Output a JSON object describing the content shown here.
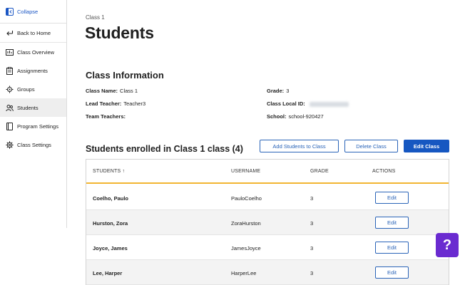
{
  "sidebar": {
    "collapse_label": "Collapse",
    "items": [
      {
        "label": "Back to Home",
        "icon": "arrow-left-icon",
        "active": false
      },
      {
        "label": "Class Overview",
        "icon": "class-overview-icon",
        "active": false
      },
      {
        "label": "Assignments",
        "icon": "clipboard-icon",
        "active": false
      },
      {
        "label": "Groups",
        "icon": "groups-icon",
        "active": false
      },
      {
        "label": "Students",
        "icon": "students-icon",
        "active": true
      },
      {
        "label": "Program Settings",
        "icon": "book-icon",
        "active": false
      },
      {
        "label": "Class Settings",
        "icon": "gear-icon",
        "active": false
      }
    ]
  },
  "header": {
    "breadcrumb": "Class 1",
    "title": "Students"
  },
  "class_info": {
    "title": "Class Information",
    "class_name_label": "Class Name:",
    "class_name": "Class 1",
    "lead_teacher_label": "Lead Teacher:",
    "lead_teacher": "Teacher3",
    "team_teachers_label": "Team Teachers:",
    "grade_label": "Grade:",
    "grade": "3",
    "class_local_id_label": "Class Local ID:",
    "school_label": "School:",
    "school": "school-920427"
  },
  "enrolled": {
    "title": "Students enrolled in Class 1 class (4)",
    "add_button": "Add Students to Class",
    "delete_button": "Delete Class",
    "edit_button": "Edit Class"
  },
  "table": {
    "columns": [
      "STUDENTS ↑",
      "USERNAME",
      "GRADE",
      "ACTIONS"
    ],
    "rows": [
      {
        "name": "Coelho, Paulo",
        "username": "PauloCoelho",
        "grade": "3",
        "action": "Edit"
      },
      {
        "name": "Hurston, Zora",
        "username": "ZoraHurston",
        "grade": "3",
        "action": "Edit"
      },
      {
        "name": "Joyce, James",
        "username": "JamesJoyce",
        "grade": "3",
        "action": "Edit"
      },
      {
        "name": "Lee, Harper",
        "username": "HarperLee",
        "grade": "3",
        "action": "Edit"
      }
    ]
  },
  "help": {
    "label": "?"
  },
  "colors": {
    "accent": "#1657c1",
    "header_underline": "#f2b531",
    "help_button": "#6a2bd0"
  }
}
